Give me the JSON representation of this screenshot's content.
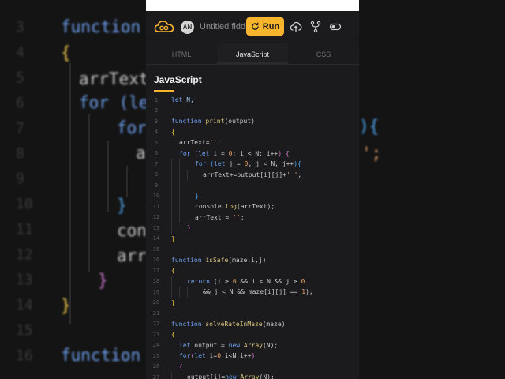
{
  "background": {
    "line_numbers": [
      "3",
      "4",
      "5",
      "6",
      "7",
      "8",
      "9",
      "10",
      "11",
      "12",
      "13",
      "14",
      "15",
      "16"
    ],
    "left_lines": [
      {
        "text": "function ",
        "cls": "k"
      },
      {
        "text": "{",
        "cls": "b1"
      },
      {
        "text": "arrText",
        "cls": "n"
      },
      {
        "text": "for (le",
        "cls": "k"
      },
      {
        "text": "for",
        "cls": "k"
      },
      {
        "text": "a",
        "cls": "n"
      },
      {
        "text": "}",
        "cls": "b3"
      },
      {
        "text": "cons",
        "cls": "n"
      },
      {
        "text": "arr",
        "cls": "n"
      },
      {
        "text": "}",
        "cls": "b2"
      },
      {
        "text": "}",
        "cls": "b1"
      },
      {
        "text": "function ",
        "cls": "k"
      }
    ],
    "right_lines": [
      {
        "text": "){",
        "cls": "b3"
      },
      {
        "text": "';",
        "cls": "s"
      }
    ]
  },
  "app": {
    "avatar_initials": "AN",
    "fiddle_title": "Untitled fiddle",
    "run_label": "Run",
    "tabs": [
      {
        "label": "HTML",
        "active": false
      },
      {
        "label": "JavaScript",
        "active": true
      },
      {
        "label": "CSS",
        "active": false
      }
    ],
    "section_title": "JavaScript",
    "accent_color": "#f7b42c"
  },
  "code_lines": [
    {
      "num": "1",
      "indent": 0,
      "tokens": [
        [
          "let ",
          "k"
        ],
        [
          "N;",
          "v"
        ]
      ]
    },
    {
      "num": "2",
      "indent": 0,
      "tokens": []
    },
    {
      "num": "3",
      "indent": 0,
      "tokens": [
        [
          "function ",
          "k"
        ],
        [
          "print",
          "f"
        ],
        [
          "(output)",
          "n"
        ]
      ]
    },
    {
      "num": "4",
      "indent": 0,
      "tokens": [
        [
          "{",
          "b1"
        ]
      ]
    },
    {
      "num": "5",
      "indent": 1,
      "tokens": [
        [
          "arrText",
          "n"
        ],
        [
          "=",
          "n"
        ],
        [
          "''",
          "s"
        ],
        [
          ";",
          "n"
        ]
      ]
    },
    {
      "num": "6",
      "indent": 1,
      "tokens": [
        [
          "for ",
          "k"
        ],
        [
          "(",
          "b2"
        ],
        [
          "let ",
          "k"
        ],
        [
          "i = ",
          "n"
        ],
        [
          "0",
          "s"
        ],
        [
          "; i < N; i++",
          "n"
        ],
        [
          ") ",
          "b2"
        ],
        [
          "{",
          "b2"
        ]
      ]
    },
    {
      "num": "7",
      "indent": 3,
      "tokens": [
        [
          "for ",
          "k"
        ],
        [
          "(",
          "b3"
        ],
        [
          "let ",
          "k"
        ],
        [
          "j = ",
          "n"
        ],
        [
          "0",
          "s"
        ],
        [
          "; j < N; j++",
          "n"
        ],
        [
          ")",
          "b3"
        ],
        [
          "{",
          "b3"
        ]
      ]
    },
    {
      "num": "8",
      "indent": 4,
      "tokens": [
        [
          "arrText+=output[i][j]+",
          "n"
        ],
        [
          "' '",
          "s"
        ],
        [
          ";",
          "n"
        ]
      ]
    },
    {
      "num": "9",
      "indent": 3,
      "tokens": []
    },
    {
      "num": "10",
      "indent": 3,
      "tokens": [
        [
          "}",
          "b3"
        ]
      ]
    },
    {
      "num": "11",
      "indent": 3,
      "tokens": [
        [
          "console.",
          "n"
        ],
        [
          "log",
          "f"
        ],
        [
          "(arrText);",
          "n"
        ]
      ]
    },
    {
      "num": "12",
      "indent": 3,
      "tokens": [
        [
          "arrText = ",
          "n"
        ],
        [
          "''",
          "s"
        ],
        [
          ";",
          "n"
        ]
      ]
    },
    {
      "num": "13",
      "indent": 2,
      "tokens": [
        [
          "}",
          "b2"
        ]
      ]
    },
    {
      "num": "14",
      "indent": 0,
      "tokens": [
        [
          "}",
          "b1"
        ]
      ]
    },
    {
      "num": "15",
      "indent": 0,
      "tokens": []
    },
    {
      "num": "16",
      "indent": 0,
      "tokens": [
        [
          "function ",
          "k"
        ],
        [
          "isSafe",
          "f"
        ],
        [
          "(maze,i,j)",
          "n"
        ]
      ]
    },
    {
      "num": "17",
      "indent": 0,
      "tokens": [
        [
          "{",
          "b1"
        ]
      ]
    },
    {
      "num": "18",
      "indent": 2,
      "tokens": [
        [
          "return ",
          "k"
        ],
        [
          "(i ",
          "n"
        ],
        [
          "≥ ",
          "n"
        ],
        [
          "0",
          "s"
        ],
        [
          " && i < N && j ",
          "n"
        ],
        [
          "≥ ",
          "n"
        ],
        [
          "0",
          "s"
        ]
      ]
    },
    {
      "num": "19",
      "indent": 4,
      "tokens": [
        [
          "&& j < N && maze[i][j] ",
          "n"
        ],
        [
          "== ",
          "n"
        ],
        [
          "1",
          "s"
        ],
        [
          ");",
          "n"
        ]
      ]
    },
    {
      "num": "20",
      "indent": 0,
      "tokens": [
        [
          "}",
          "b1"
        ]
      ]
    },
    {
      "num": "21",
      "indent": 0,
      "tokens": []
    },
    {
      "num": "22",
      "indent": 0,
      "tokens": [
        [
          "function ",
          "k"
        ],
        [
          "solveRateInMaze",
          "f"
        ],
        [
          "(maze)",
          "n"
        ]
      ]
    },
    {
      "num": "23",
      "indent": 0,
      "tokens": [
        [
          "{",
          "b1"
        ]
      ]
    },
    {
      "num": "24",
      "indent": 1,
      "tokens": [
        [
          "let ",
          "k"
        ],
        [
          "output = ",
          "n"
        ],
        [
          "new ",
          "k"
        ],
        [
          "Array",
          "f"
        ],
        [
          "(N);",
          "n"
        ]
      ]
    },
    {
      "num": "25",
      "indent": 1,
      "tokens": [
        [
          "for",
          "k"
        ],
        [
          "(",
          "b2"
        ],
        [
          "let ",
          "k"
        ],
        [
          "i=",
          "n"
        ],
        [
          "0",
          "s"
        ],
        [
          ";i<N;i++",
          "n"
        ],
        [
          ")",
          "b2"
        ]
      ]
    },
    {
      "num": "26",
      "indent": 1,
      "tokens": [
        [
          "{",
          "b2"
        ]
      ]
    },
    {
      "num": "27",
      "indent": 2,
      "tokens": [
        [
          "output[i]=",
          "n"
        ],
        [
          "new ",
          "k"
        ],
        [
          "Array",
          "f"
        ],
        [
          "(N);",
          "n"
        ]
      ]
    }
  ]
}
